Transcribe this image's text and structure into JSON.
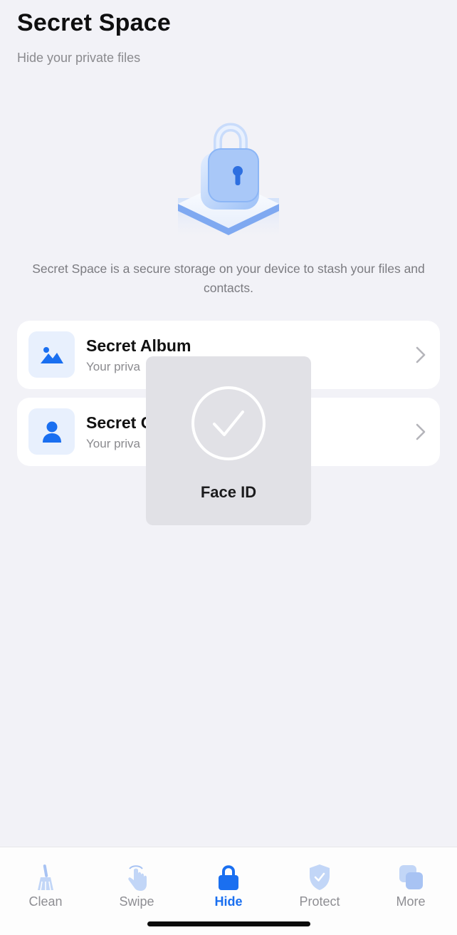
{
  "header": {
    "title": "Secret Space",
    "subtitle": "Hide your private files"
  },
  "hero": {
    "icon": "padlock-illustration"
  },
  "description": "Secret Space is a secure storage on your device to stash your files and contacts.",
  "cards": [
    {
      "title": "Secret Album",
      "subtitle": "Your priva",
      "icon": "photo-icon"
    },
    {
      "title": "Secret C",
      "subtitle": "Your priva",
      "icon": "person-icon"
    }
  ],
  "faceid": {
    "label": "Face ID",
    "icon": "checkmark-circle-icon"
  },
  "tabs": [
    {
      "label": "Clean",
      "icon": "broom-icon",
      "active": false
    },
    {
      "label": "Swipe",
      "icon": "swipe-hand-icon",
      "active": false
    },
    {
      "label": "Hide",
      "icon": "lock-icon",
      "active": true
    },
    {
      "label": "Protect",
      "icon": "shield-check-icon",
      "active": false
    },
    {
      "label": "More",
      "icon": "squares-icon",
      "active": false
    }
  ],
  "colors": {
    "accent": "#1a6ff0",
    "background": "#f2f2f7",
    "card": "#ffffff",
    "icon_tile": "#e8f0fd",
    "faceid_panel": "#e1e1e6"
  }
}
